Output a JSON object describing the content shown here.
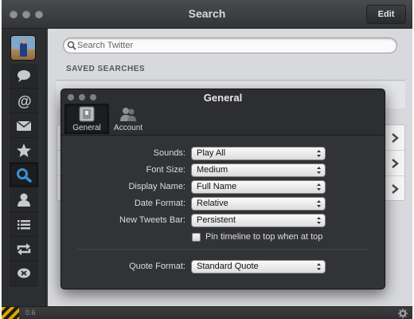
{
  "window": {
    "title": "Search",
    "edit_label": "Edit"
  },
  "sidebar": {
    "items": [
      {
        "icon": "speech-bubble-icon"
      },
      {
        "icon": "at-sign-icon"
      },
      {
        "icon": "envelope-icon"
      },
      {
        "icon": "star-icon"
      },
      {
        "icon": "search-icon",
        "active": true
      },
      {
        "icon": "person-icon"
      },
      {
        "icon": "list-icon"
      },
      {
        "icon": "retweet-icon"
      },
      {
        "icon": "mute-icon"
      }
    ]
  },
  "search": {
    "placeholder": "Search Twitter",
    "value": ""
  },
  "saved": {
    "heading": "SAVED SEARCHES"
  },
  "status": {
    "version": "0.6"
  },
  "dialog": {
    "title": "General",
    "tabs": [
      {
        "label": "General",
        "icon": "switch-icon",
        "selected": true
      },
      {
        "label": "Account",
        "icon": "accounts-icon",
        "selected": false
      }
    ],
    "settings": {
      "sounds": {
        "label": "Sounds:",
        "value": "Play All"
      },
      "font_size": {
        "label": "Font Size:",
        "value": "Medium"
      },
      "display_name": {
        "label": "Display Name:",
        "value": "Full Name"
      },
      "date_format": {
        "label": "Date Format:",
        "value": "Relative"
      },
      "new_tweets_bar": {
        "label": "New Tweets Bar:",
        "value": "Persistent"
      },
      "pin_timeline": {
        "label": "Pin timeline to top when at top",
        "checked": false
      },
      "quote_format": {
        "label": "Quote Format:",
        "value": "Standard Quote"
      }
    }
  },
  "colors": {
    "window_dark": "#3a3b3d",
    "content_bg": "#d8d9dc",
    "dialog_bg": "#323335",
    "sidebar_active_icon": "#3a8fd6"
  }
}
